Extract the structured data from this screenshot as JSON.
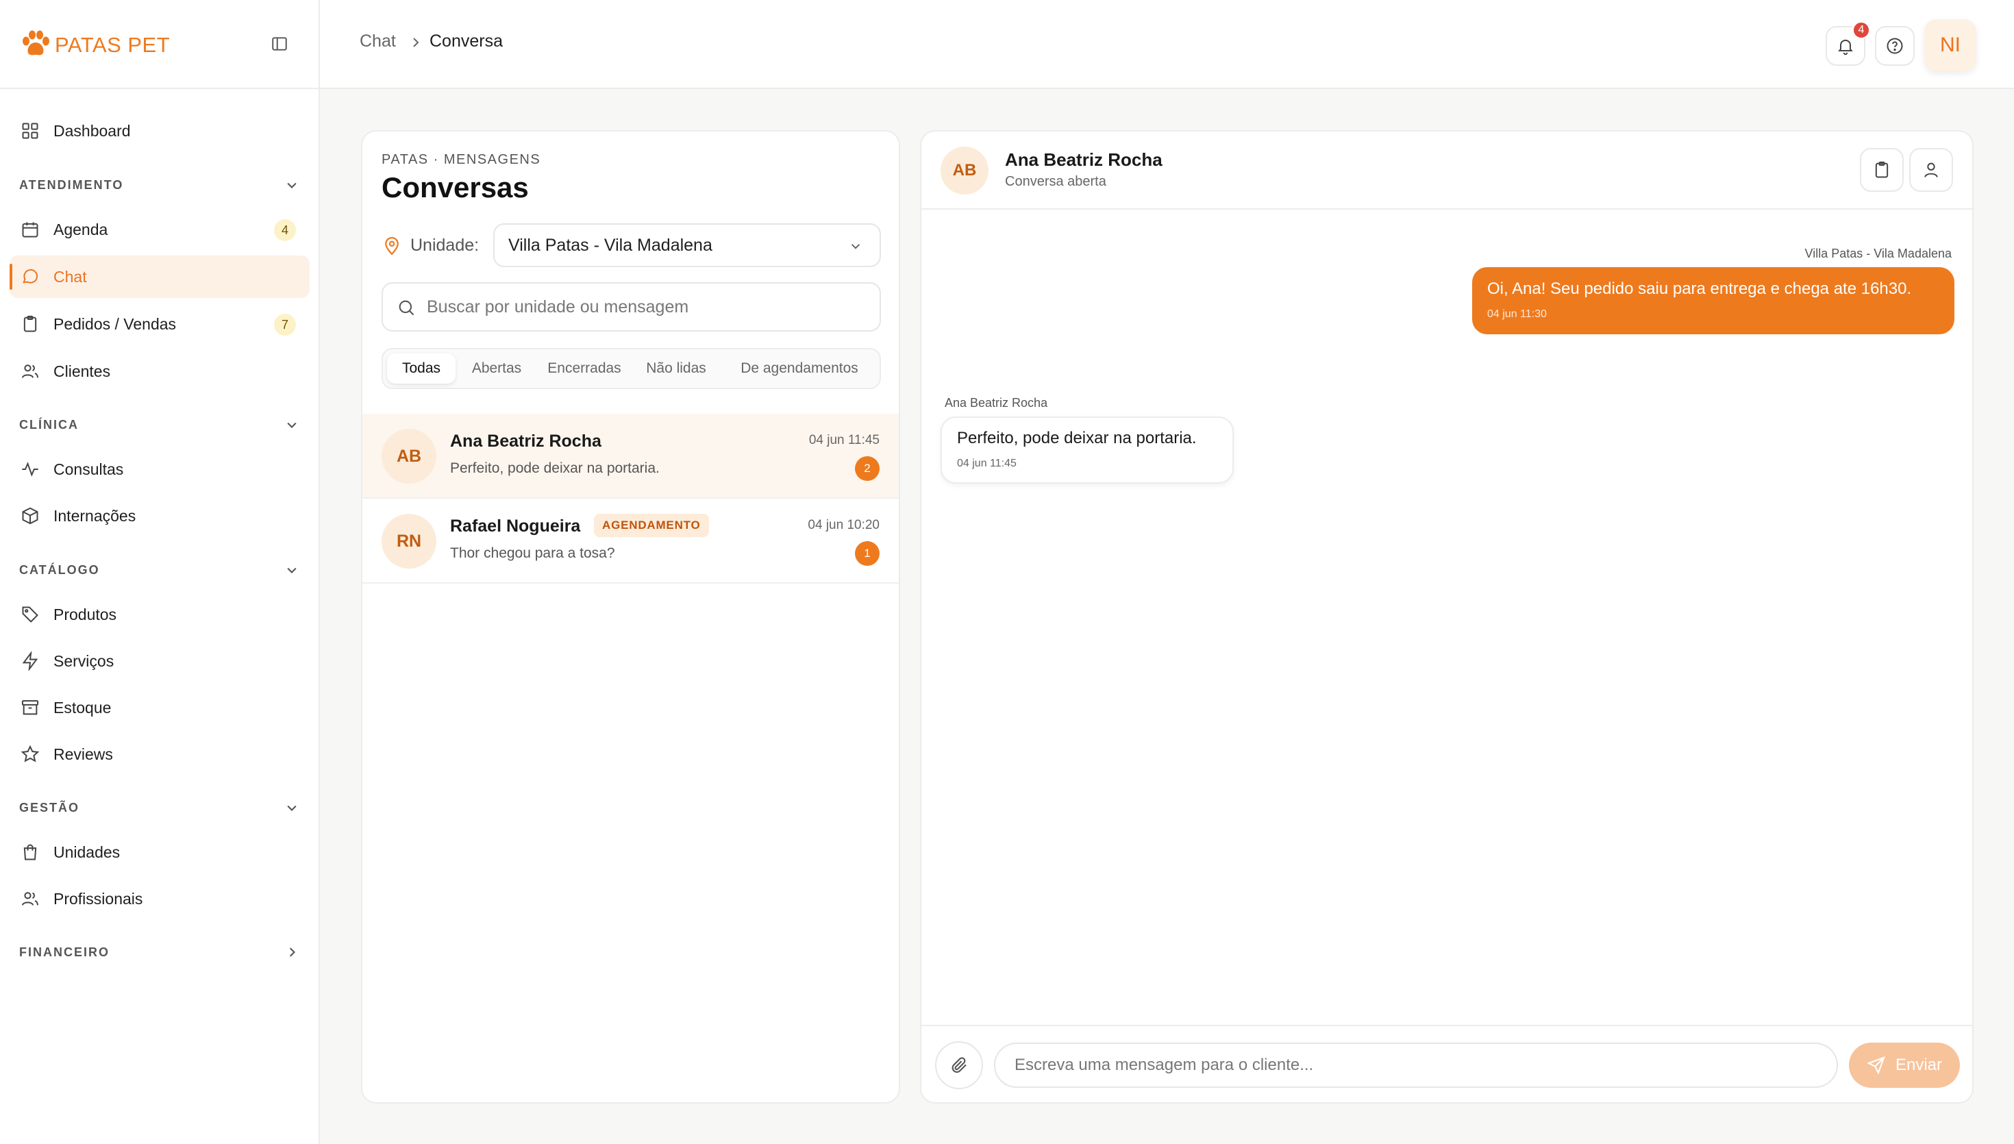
{
  "brand": {
    "name": "PATAS PET",
    "logo_icon": "paw-icon",
    "accent": "#ee7a1e"
  },
  "sidebar": {
    "dashboard": "Dashboard",
    "sections": [
      {
        "title": "ATENDIMENTO",
        "items": [
          {
            "label": "Agenda",
            "icon": "calendar-icon",
            "badge": "4"
          },
          {
            "label": "Chat",
            "icon": "chat-bubble-icon",
            "active": true
          },
          {
            "label": "Pedidos / Vendas",
            "icon": "clipboard-icon",
            "badge": "7"
          },
          {
            "label": "Clientes",
            "icon": "users-icon"
          }
        ]
      },
      {
        "title": "CLÍNICA",
        "items": [
          {
            "label": "Consultas",
            "icon": "activity-icon"
          },
          {
            "label": "Internações",
            "icon": "box-icon"
          }
        ]
      },
      {
        "title": "CATÁLOGO",
        "items": [
          {
            "label": "Produtos",
            "icon": "tag-icon"
          },
          {
            "label": "Serviços",
            "icon": "lightning-icon"
          },
          {
            "label": "Estoque",
            "icon": "archive-icon"
          },
          {
            "label": "Reviews",
            "icon": "star-icon"
          }
        ]
      },
      {
        "title": "GESTÃO",
        "items": [
          {
            "label": "Unidades",
            "icon": "shopping-bag-icon"
          },
          {
            "label": "Profissionais",
            "icon": "users-icon"
          }
        ]
      },
      {
        "title": "FINANCEIRO",
        "items": []
      }
    ]
  },
  "topbar": {
    "breadcrumb": [
      "Chat",
      "Conversa"
    ],
    "notifications_count": "4",
    "user_initials": "NI"
  },
  "conversations": {
    "eyebrow": "PATAS · MENSAGENS",
    "title": "Conversas",
    "unit_label": "Unidade:",
    "unit_value": "Villa Patas - Vila Madalena",
    "search_placeholder": "Buscar por unidade ou mensagem",
    "tabs": [
      "Todas",
      "Abertas",
      "Encerradas",
      "Não lidas",
      "De agendamentos"
    ],
    "active_tab": "Todas",
    "items": [
      {
        "initials": "AB",
        "name": "Ana Beatriz Rocha",
        "preview": "Perfeito, pode deixar na portaria.",
        "time": "04 jun 11:45",
        "unread": "2",
        "tag": ""
      },
      {
        "initials": "RN",
        "name": "Rafael Nogueira",
        "preview": "Thor chegou para a tosa?",
        "time": "04 jun 10:20",
        "unread": "1",
        "tag": "AGENDAMENTO"
      }
    ]
  },
  "chat": {
    "contact_initials": "AB",
    "contact_name": "Ana Beatriz Rocha",
    "status": "Conversa aberta",
    "messages": [
      {
        "direction": "out",
        "sender": "Villa Patas - Vila Madalena",
        "text": "Oi, Ana! Seu pedido saiu para entrega e chega ate 16h30.",
        "time": "04 jun 11:30"
      },
      {
        "direction": "in",
        "sender": "Ana Beatriz Rocha",
        "text": "Perfeito, pode deixar na portaria.",
        "time": "04 jun 11:45"
      }
    ],
    "composer_placeholder": "Escreva uma mensagem para o cliente...",
    "send_label": "Enviar"
  }
}
